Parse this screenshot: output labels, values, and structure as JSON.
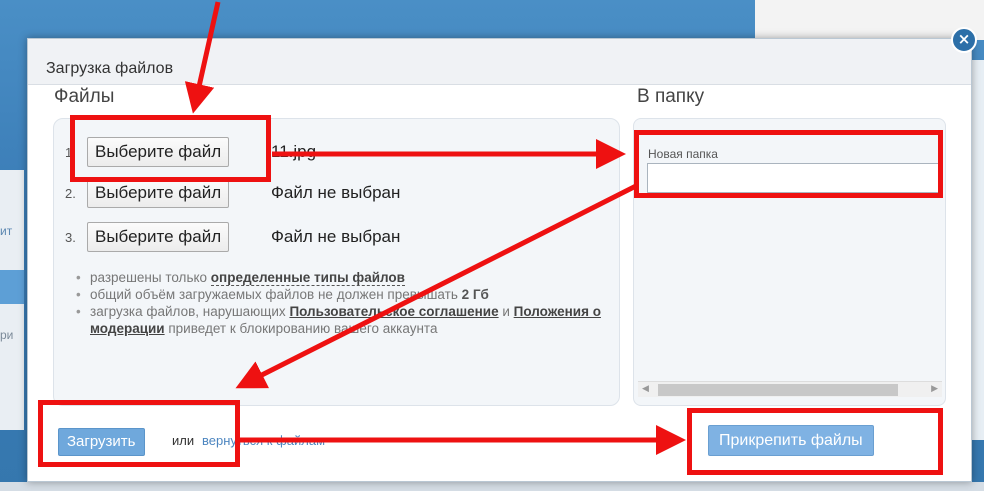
{
  "dialog": {
    "title": "Загрузка файлов",
    "close_icon": "×",
    "files_label": "Файлы",
    "folder_label": "В папку"
  },
  "files": [
    {
      "num": "1.",
      "button": "Выберите файл",
      "name": "11.jpg"
    },
    {
      "num": "2.",
      "button": "Выберите файл",
      "name": "Файл не выбран"
    },
    {
      "num": "3.",
      "button": "Выберите файл",
      "name": "Файл не выбран"
    }
  ],
  "rules": {
    "r1_text": "разрешены только ",
    "r1_link": "определенные типы файлов",
    "r2_text": "общий объём загружаемых файлов не должен превышать ",
    "r2_bold": "2 Гб",
    "r3_text": "загрузка файлов, нарушающих ",
    "r3_link1": "Пользовательское соглашение",
    "r3_and": " и ",
    "r3_link2": "Положения о модерации",
    "r3_tail": " приведет к блокированию вашего аккаунта"
  },
  "folder": {
    "caption": "Новая папка",
    "input_value": "",
    "scroll_left": "◀",
    "scroll_right": "▶"
  },
  "footer": {
    "upload_button": "Загрузить",
    "or": "или",
    "back_link": "вернуться к файлам",
    "attach_button": "Прикрепить файлы"
  },
  "colors": {
    "annotation": "#ee1111",
    "primary_button": "#6fa8dc",
    "backdrop": "#3a7ab4"
  }
}
